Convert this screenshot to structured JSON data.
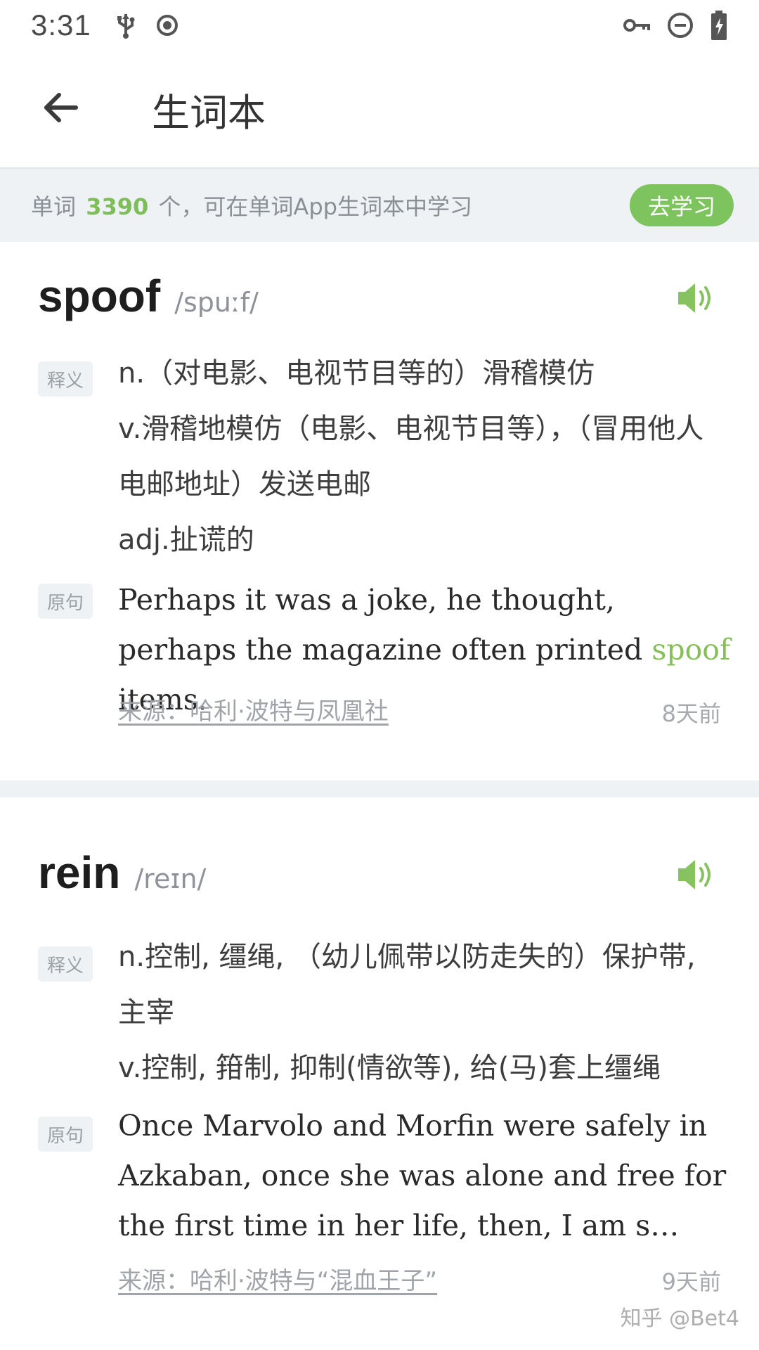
{
  "status_bar": {
    "time": "3:31",
    "left_icons": [
      "usb-icon",
      "record-icon"
    ],
    "right_icons": [
      "vpn-key-icon",
      "do-not-disturb-icon",
      "battery-charging-icon"
    ]
  },
  "app_bar": {
    "back_icon": "arrow-back-icon",
    "title": "生词本"
  },
  "banner": {
    "prefix": "单词",
    "count": "3390",
    "suffix": "个，可在单词App生词本中学习",
    "button_label": "去学习"
  },
  "colors": {
    "accent_green": "#7dc45e",
    "banner_bg": "#eef2f5",
    "tag_bg": "#eef2f5"
  },
  "words": [
    {
      "headword": "spoof",
      "phonetic": "/spuːf/",
      "speaker_icon": "speaker-icon",
      "definition_tag": "释义",
      "definitions": [
        "n.（对电影、电视节目等的）滑稽模仿",
        "v.滑稽地模仿（电影、电视节目等），（冒用他人电邮地址）发送电邮",
        "adj.扯谎的"
      ],
      "example_tag": "原句",
      "example_before": "Perhaps it was a joke, he thought, perhaps the magazine often printed ",
      "example_highlight": "spoof",
      "example_after": " items.",
      "source": "来源：哈利·波特与凤凰社",
      "time_ago": "8天前"
    },
    {
      "headword": "rein",
      "phonetic": "/reɪn/",
      "speaker_icon": "speaker-icon",
      "definition_tag": "释义",
      "definitions": [
        "n.控制, 缰绳, （幼儿佩带以防走失的）保护带, 主宰",
        "v.控制, 箝制, 抑制(情欲等), 给(马)套上缰绳"
      ],
      "example_tag": "原句",
      "example_text": "Once Marvolo and Morfin were safely in Azkaban, once she was alone and free for the first time in her life, then, I am s…",
      "source": "来源：哈利·波特与“混血王子”",
      "time_ago": "9天前"
    }
  ],
  "watermark": "知乎 @Bet4"
}
